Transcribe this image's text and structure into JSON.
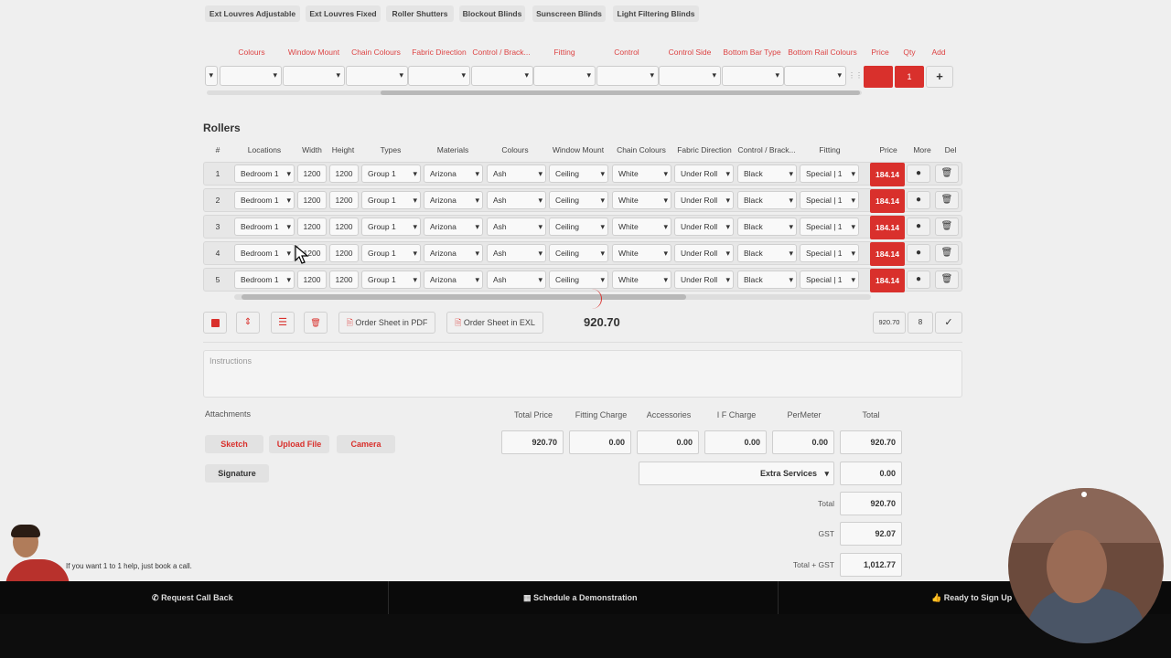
{
  "top_tabs": [
    "Ext Louvres Adjustable",
    "Ext Louvres Fixed",
    "Roller Shutters",
    "Blockout Blinds",
    "Sunscreen Blinds",
    "Light Filtering Blinds"
  ],
  "entry_headers": [
    "Colours",
    "Window Mount",
    "Chain Colours",
    "Fabric Direction",
    "Control / Brack...",
    "Fitting",
    "Control",
    "Control Side",
    "Bottom Bar Type",
    "Bottom Rail Colours",
    "Price",
    "Qty",
    "Add"
  ],
  "entry": {
    "qty": "1",
    "add_icon": "+"
  },
  "section_title": "Rollers",
  "table_headers": [
    "#",
    "Locations",
    "Width",
    "Height",
    "Types",
    "Materials",
    "Colours",
    "Window Mount",
    "Chain Colours",
    "Fabric Direction",
    "Control / Brack...",
    "Fitting",
    "Price",
    "More",
    "Del"
  ],
  "rows": [
    {
      "num": "1",
      "location": "Bedroom 1",
      "width": "1200",
      "height": "1200",
      "type": "Group 1",
      "material": "Arizona",
      "colour": "Ash",
      "mount": "Ceiling",
      "chain": "White",
      "direction": "Under Roll",
      "control": "Black",
      "fitting": "Special | 1",
      "price": "184.14"
    },
    {
      "num": "2",
      "location": "Bedroom 1",
      "width": "1200",
      "height": "1200",
      "type": "Group 1",
      "material": "Arizona",
      "colour": "Ash",
      "mount": "Ceiling",
      "chain": "White",
      "direction": "Under Roll",
      "control": "Black",
      "fitting": "Special | 1",
      "price": "184.14"
    },
    {
      "num": "3",
      "location": "Bedroom 1",
      "width": "1200",
      "height": "1200",
      "type": "Group 1",
      "material": "Arizona",
      "colour": "Ash",
      "mount": "Ceiling",
      "chain": "White",
      "direction": "Under Roll",
      "control": "Black",
      "fitting": "Special | 1",
      "price": "184.14"
    },
    {
      "num": "4",
      "location": "Bedroom 1",
      "width": "1200",
      "height": "1200",
      "type": "Group 1",
      "material": "Arizona",
      "colour": "Ash",
      "mount": "Ceiling",
      "chain": "White",
      "direction": "Under Roll",
      "control": "Black",
      "fitting": "Special | 1",
      "price": "184.14"
    },
    {
      "num": "5",
      "location": "Bedroom 1",
      "width": "1200",
      "height": "1200",
      "type": "Group 1",
      "material": "Arizona",
      "colour": "Ash",
      "mount": "Ceiling",
      "chain": "White",
      "direction": "Under Roll",
      "control": "Black",
      "fitting": "Special | 1",
      "price": "184.14"
    }
  ],
  "toolbar": {
    "pdf_label": "Order Sheet in PDF",
    "exl_label": "Order Sheet in EXL",
    "total_display": "920.70",
    "summary_total": "920.70",
    "summary_count": "8",
    "confirm_icon": "✓"
  },
  "instructions_placeholder": "Instructions",
  "attachments": {
    "title": "Attachments",
    "sketch": "Sketch",
    "upload": "Upload File",
    "camera": "Camera",
    "signature": "Signature"
  },
  "totals": {
    "labels": [
      "Total Price",
      "Fitting Charge",
      "Accessories",
      "I F Charge",
      "PerMeter",
      "Total"
    ],
    "values": [
      "920.70",
      "0.00",
      "0.00",
      "0.00",
      "0.00",
      "920.70"
    ],
    "extra_services_label": "Extra Services",
    "extra_services_value": "0.00",
    "total_label": "Total",
    "total_value": "920.70",
    "gst_label": "GST",
    "gst_value": "92.07",
    "grand_label": "Total + GST",
    "grand_value": "1,012.77"
  },
  "footer": {
    "help_text": "If you want 1 to 1 help, just book a call.",
    "callback": "Request Call Back",
    "demo": "Schedule a Demonstration",
    "signup": "Ready to Sign Up"
  },
  "colors": {
    "accent_red": "#d9302c",
    "footer_bg": "#0a0a0a"
  }
}
